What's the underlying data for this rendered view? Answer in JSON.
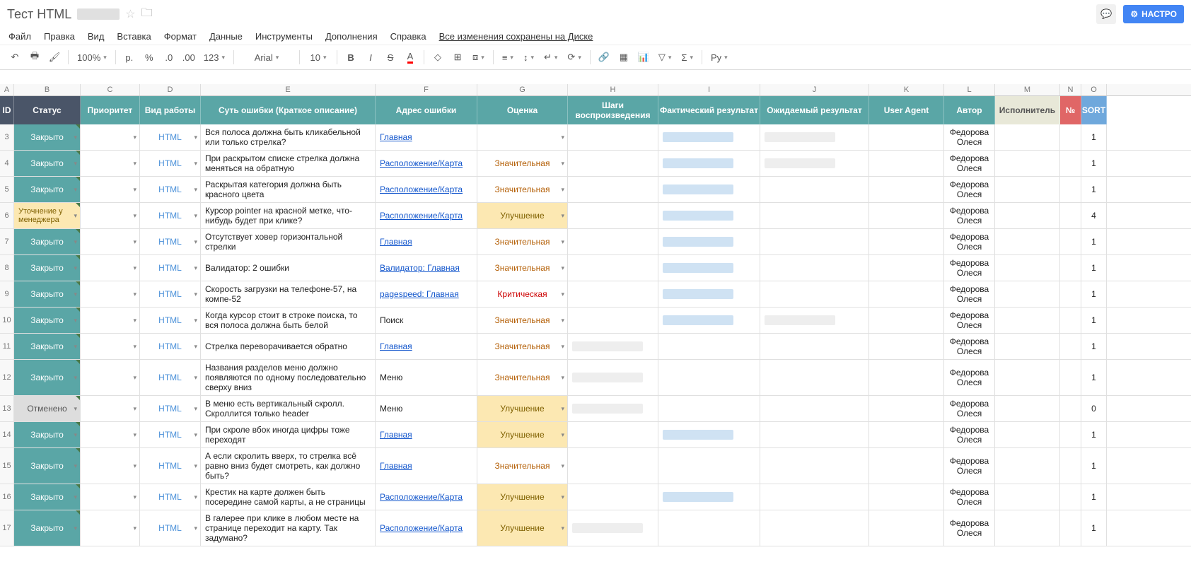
{
  "doc": {
    "title": "Тест HTML"
  },
  "menu": {
    "file": "Файл",
    "edit": "Правка",
    "view": "Вид",
    "insert": "Вставка",
    "format": "Формат",
    "data": "Данные",
    "tools": "Инструменты",
    "addons": "Дополнения",
    "help": "Справка",
    "save_msg": "Все изменения сохранены на Диске"
  },
  "toolbar": {
    "zoom": "100%",
    "currency": "р.",
    "percent": "%",
    "dec_less": ".0",
    "dec_more": ".00",
    "numfmt": "123",
    "font": "Arial",
    "size": "10",
    "lang": "Ру",
    "settings": "НАСТРО"
  },
  "cols": {
    "A": "A",
    "B": "B",
    "C": "C",
    "D": "D",
    "E": "E",
    "F": "F",
    "G": "G",
    "H": "H",
    "I": "I",
    "J": "J",
    "K": "K",
    "L": "L",
    "M": "M",
    "N": "N",
    "O": "O"
  },
  "headers": {
    "id": "ID",
    "status": "Статус",
    "priority": "Приоритет",
    "work": "Вид работы",
    "bug": "Суть ошибки (Краткое описание)",
    "addr": "Адрес ошибки",
    "rating": "Оценка",
    "steps": "Шаги воспроизведения",
    "actual": "Фактический результат",
    "expected": "Ожидаемый результат",
    "ua": "User Agent",
    "author": "Автор",
    "exec": "Исполнитель",
    "num": "№",
    "sort": "SORT"
  },
  "statuses": {
    "closed": "Закрыто",
    "clarify": "Уточнение у менеджера",
    "cancel": "Отменено"
  },
  "work": {
    "html": "HTML"
  },
  "ratings": {
    "sig": "Значительная",
    "crit": "Критическая",
    "imp": "Улучшение"
  },
  "author": "Федорова Олеся",
  "rows": [
    {
      "n": "3",
      "status": "closed",
      "bug": "Вся полоса должна быть кликабельной или только стрелка?",
      "addr": "Главная",
      "rating": "",
      "actual": "blue",
      "expected": "gray",
      "sort": "1"
    },
    {
      "n": "4",
      "status": "closed",
      "bug": "При раскрытом списке стрелка должна меняться на обратную",
      "addr": "Расположение/Карта",
      "rating": "sig",
      "actual": "blue",
      "expected": "gray",
      "sort": "1"
    },
    {
      "n": "5",
      "status": "closed",
      "bug": "Раскрытая категория должна быть красного цвета",
      "addr": "Расположение/Карта",
      "rating": "sig",
      "actual": "blue",
      "expected": "",
      "sort": "1"
    },
    {
      "n": "6",
      "status": "clarify",
      "bug": "Курсор pointer  на красной метке, что-нибудь будет при клике?",
      "addr": "Расположение/Карта",
      "rating": "imp",
      "actual": "blue",
      "expected": "",
      "sort": "4"
    },
    {
      "n": "7",
      "status": "closed",
      "bug": "Отсутствует ховер горизонтальной стрелки",
      "addr": "Главная",
      "rating": "sig",
      "actual": "blue",
      "expected": "",
      "sort": "1"
    },
    {
      "n": "8",
      "status": "closed",
      "bug": "Валидатор: 2 ошибки",
      "addr": "Валидатор: Главная",
      "rating": "sig",
      "actual": "blue",
      "expected": "",
      "sort": "1"
    },
    {
      "n": "9",
      "status": "closed",
      "bug": "Скорость загрузки на телефоне-57, на компе-52",
      "addr": "pagespeed: Главная",
      "rating": "crit",
      "actual": "blue",
      "expected": "",
      "sort": "1"
    },
    {
      "n": "10",
      "status": "closed",
      "bug": "Когда курсор стоит в строке поиска, то вся полоса должна быть белой",
      "addr": "Поиск",
      "rating": "sig",
      "actual": "blue",
      "expected": "gray",
      "sort": "1"
    },
    {
      "n": "11",
      "status": "closed",
      "bug": "Стрелка переворачивается обратно",
      "addr": "Главная",
      "rating": "sig",
      "steps": "gray",
      "actual": "",
      "expected": "",
      "sort": "1"
    },
    {
      "n": "12",
      "status": "closed",
      "bug": "Названия разделов меню должно появляются по одному последовательно сверху вниз",
      "addr": "Меню",
      "rating": "sig",
      "steps": "gray",
      "actual": "",
      "expected": "",
      "sort": "1"
    },
    {
      "n": "13",
      "status": "cancel",
      "bug": "В меню есть вертикальный скролл. Скроллится только header",
      "addr": "Меню",
      "rating": "imp",
      "steps": "gray",
      "actual": "",
      "expected": "",
      "sort": "0"
    },
    {
      "n": "14",
      "status": "closed",
      "bug": "При скроле вбок иногда цифры тоже переходят",
      "addr": "Главная",
      "rating": "imp",
      "actual": "blue",
      "expected": "",
      "sort": "1"
    },
    {
      "n": "15",
      "status": "closed",
      "bug": "А если скролить вверх, то стрелка всё равно вниз будет смотреть, как должно быть?",
      "addr": "Главная",
      "rating": "sig",
      "actual": "",
      "expected": "",
      "sort": "1"
    },
    {
      "n": "16",
      "status": "closed",
      "bug": "Крестик на карте должен быть посередине самой карты, а не страницы",
      "addr": "Расположение/Карта",
      "rating": "imp",
      "actual": "blue",
      "expected": "",
      "sort": "1"
    },
    {
      "n": "17",
      "status": "closed",
      "bug": "В галерее при клике в любом месте на странице переходит на карту. Так задумано?",
      "addr": "Расположение/Карта",
      "rating": "imp",
      "steps": "gray",
      "actual": "",
      "expected": "",
      "sort": "1"
    }
  ]
}
